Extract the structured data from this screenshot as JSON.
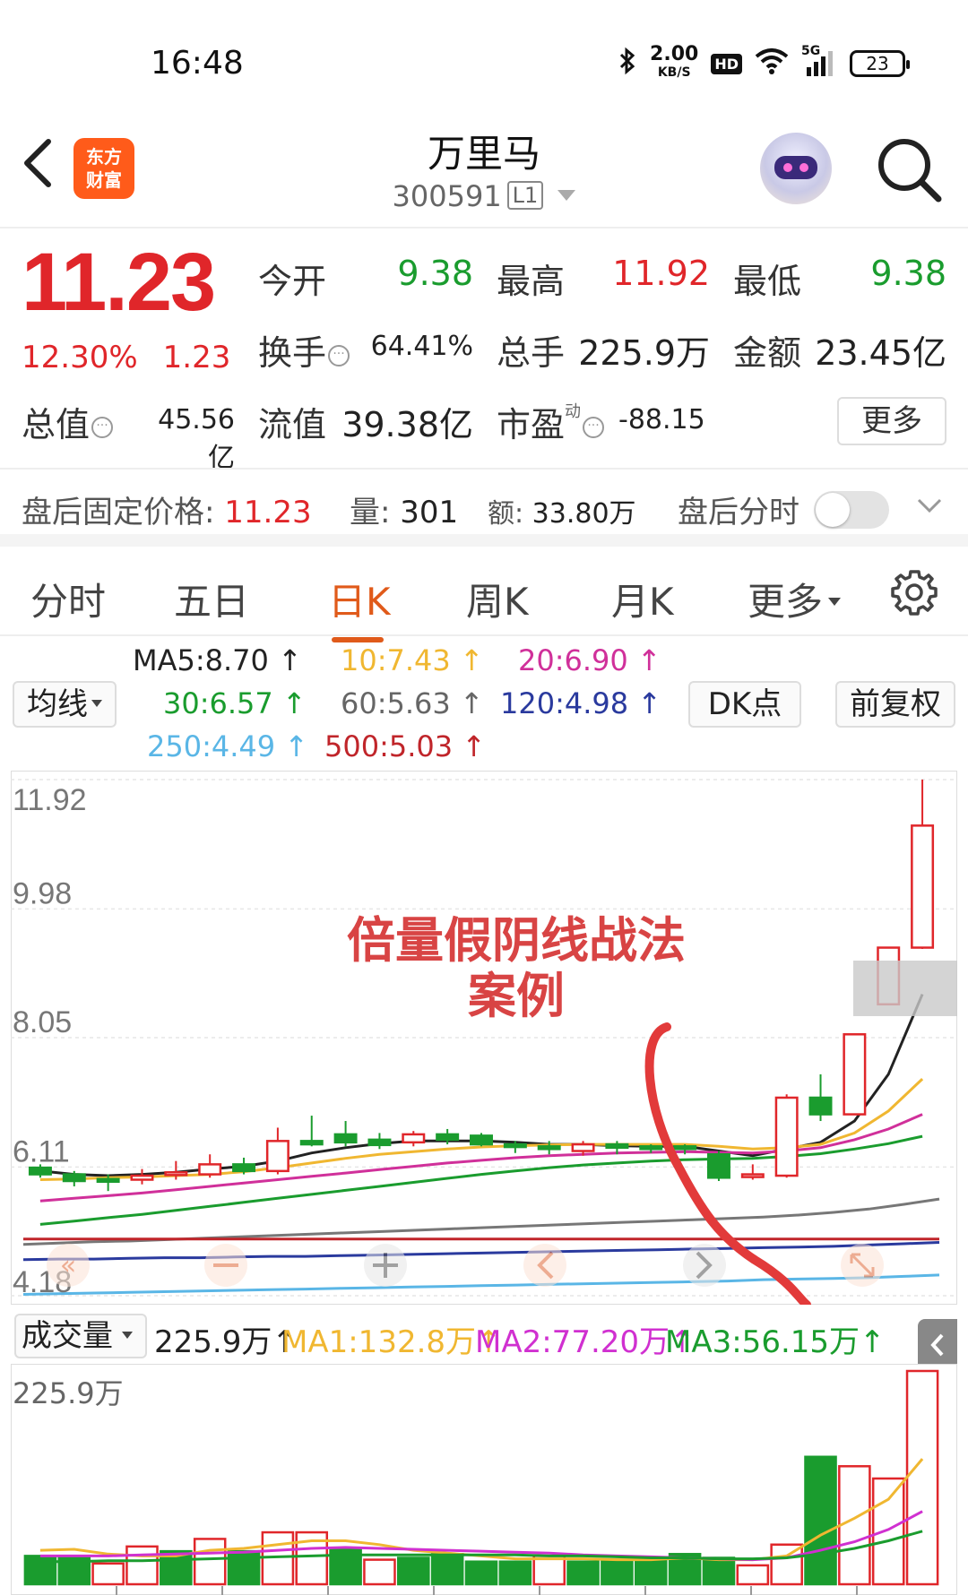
{
  "status": {
    "time": "16:48",
    "speed_top": "2.00",
    "speed_unit": "KB/S",
    "hd": "HD",
    "net": "5G",
    "battery": "23"
  },
  "header": {
    "logo_line1": "东方",
    "logo_line2": "财富",
    "title": "万里马",
    "code": "300591",
    "level": "L1"
  },
  "quote": {
    "price": "11.23",
    "change_pct": "12.30%",
    "change_amt": "1.23",
    "open_label": "今开",
    "open": "9.38",
    "high_label": "最高",
    "high": "11.92",
    "low_label": "最低",
    "low": "9.38",
    "turnover_label": "换手",
    "turnover": "64.41%",
    "volume_label": "总手",
    "volume": "225.9万",
    "amount_label": "金额",
    "amount": "23.45亿",
    "mktcap_label": "总值",
    "mktcap": "45.56亿",
    "float_label": "流值",
    "float_cap": "39.38亿",
    "pe_label": "市盈",
    "pe_sup": "动",
    "pe": "-88.15",
    "more": "更多"
  },
  "after_hours": {
    "price_label": "盘后固定价格:",
    "price": "11.23",
    "vol_label": "量:",
    "vol": "301",
    "amt_label": "额:",
    "amt": "33.80万",
    "intraday_label": "盘后分时"
  },
  "tabs": [
    "分时",
    "五日",
    "日K",
    "周K",
    "月K",
    "更多"
  ],
  "ma_legend": {
    "selector": "均线",
    "ma5": "MA5:8.70",
    "ma10": "10:7.43",
    "ma20": "20:6.90",
    "ma30": "30:6.57",
    "ma60": "60:5.63",
    "ma120": "120:4.98",
    "ma250": "250:4.49",
    "ma500": "500:5.03",
    "dk": "DK点",
    "adjust": "前复权",
    "arrow": "↑"
  },
  "colors": {
    "up": "#e0262a",
    "down": "#1a9c2e",
    "ma5": "#222222",
    "ma10": "#f0b731",
    "ma20": "#d0309a",
    "ma30": "#1a9c2e",
    "ma60": "#777777",
    "ma120": "#2a3a9e",
    "ma250": "#5ab6e6",
    "ma500": "#c0252a"
  },
  "annotation": {
    "line1": "倍量假阴线战法",
    "line2": "案例"
  },
  "chart_data": [
    {
      "type": "candlestick",
      "y_ticks": [
        "11.92",
        "9.98",
        "8.05",
        "6.11",
        "4.18"
      ],
      "ylim": [
        4.18,
        11.92
      ],
      "candles": [
        {
          "o": 6.1,
          "c": 6.0,
          "h": 6.15,
          "l": 5.95
        },
        {
          "o": 6.0,
          "c": 5.9,
          "h": 6.05,
          "l": 5.82
        },
        {
          "o": 5.93,
          "c": 5.92,
          "h": 6.0,
          "l": 5.75
        },
        {
          "o": 5.92,
          "c": 5.98,
          "h": 6.08,
          "l": 5.85
        },
        {
          "o": 6.0,
          "c": 6.03,
          "h": 6.2,
          "l": 5.92
        },
        {
          "o": 6.0,
          "c": 6.15,
          "h": 6.3,
          "l": 5.95
        },
        {
          "o": 6.15,
          "c": 6.05,
          "h": 6.25,
          "l": 6.0
        },
        {
          "o": 6.05,
          "c": 6.5,
          "h": 6.7,
          "l": 6.0
        },
        {
          "o": 6.5,
          "c": 6.45,
          "h": 6.88,
          "l": 6.42
        },
        {
          "o": 6.6,
          "c": 6.48,
          "h": 6.8,
          "l": 6.42
        },
        {
          "o": 6.52,
          "c": 6.44,
          "h": 6.62,
          "l": 6.38
        },
        {
          "o": 6.48,
          "c": 6.6,
          "h": 6.65,
          "l": 6.42
        },
        {
          "o": 6.6,
          "c": 6.52,
          "h": 6.68,
          "l": 6.45
        },
        {
          "o": 6.58,
          "c": 6.45,
          "h": 6.62,
          "l": 6.42
        },
        {
          "o": 6.45,
          "c": 6.43,
          "h": 6.5,
          "l": 6.32
        },
        {
          "o": 6.42,
          "c": 6.41,
          "h": 6.5,
          "l": 6.3
        },
        {
          "o": 6.35,
          "c": 6.45,
          "h": 6.5,
          "l": 6.28
        },
        {
          "o": 6.45,
          "c": 6.4,
          "h": 6.5,
          "l": 6.3
        },
        {
          "o": 6.42,
          "c": 6.4,
          "h": 6.45,
          "l": 6.32
        },
        {
          "o": 6.42,
          "c": 6.38,
          "h": 6.45,
          "l": 6.3
        },
        {
          "o": 6.3,
          "c": 5.95,
          "h": 6.35,
          "l": 5.9
        },
        {
          "o": 6.0,
          "c": 6.0,
          "h": 6.15,
          "l": 5.92
        },
        {
          "o": 5.98,
          "c": 7.15,
          "h": 7.2,
          "l": 5.95
        },
        {
          "o": 7.15,
          "c": 6.9,
          "h": 7.5,
          "l": 6.8
        },
        {
          "o": 6.9,
          "c": 8.1,
          "h": 8.1,
          "l": 6.9
        },
        {
          "o": 8.55,
          "c": 9.4,
          "h": 9.4,
          "l": 8.55
        },
        {
          "o": 9.4,
          "c": 11.23,
          "h": 11.92,
          "l": 9.38
        }
      ],
      "ma_lines": {
        "MA5": [
          6.05,
          6.0,
          5.98,
          6.0,
          6.03,
          6.08,
          6.12,
          6.2,
          6.32,
          6.4,
          6.46,
          6.5,
          6.5,
          6.5,
          6.48,
          6.45,
          6.45,
          6.43,
          6.42,
          6.42,
          6.35,
          6.28,
          6.38,
          6.48,
          6.8,
          7.5,
          8.7
        ],
        "MA10": [
          5.92,
          5.93,
          5.95,
          5.96,
          5.98,
          6.0,
          6.04,
          6.1,
          6.17,
          6.24,
          6.3,
          6.34,
          6.38,
          6.41,
          6.43,
          6.44,
          6.45,
          6.45,
          6.45,
          6.45,
          6.42,
          6.38,
          6.4,
          6.45,
          6.62,
          6.95,
          7.43
        ],
        "MA20": [
          5.6,
          5.64,
          5.68,
          5.72,
          5.77,
          5.82,
          5.87,
          5.92,
          5.97,
          6.02,
          6.07,
          6.12,
          6.17,
          6.21,
          6.25,
          6.28,
          6.3,
          6.32,
          6.33,
          6.34,
          6.33,
          6.32,
          6.35,
          6.4,
          6.52,
          6.68,
          6.9
        ],
        "MA30": [
          5.25,
          5.3,
          5.35,
          5.4,
          5.46,
          5.52,
          5.58,
          5.64,
          5.7,
          5.76,
          5.82,
          5.88,
          5.94,
          6.0,
          6.05,
          6.1,
          6.14,
          6.17,
          6.2,
          6.22,
          6.23,
          6.24,
          6.27,
          6.31,
          6.38,
          6.46,
          6.57
        ],
        "MA60": [
          4.95,
          4.97,
          4.99,
          5.0,
          5.02,
          5.04,
          5.06,
          5.08,
          5.1,
          5.12,
          5.14,
          5.16,
          5.18,
          5.2,
          5.22,
          5.24,
          5.26,
          5.28,
          5.3,
          5.32,
          5.34,
          5.36,
          5.39,
          5.43,
          5.48,
          5.55,
          5.63
        ],
        "MA120": [
          4.72,
          4.73,
          4.73,
          4.74,
          4.75,
          4.75,
          4.76,
          4.77,
          4.77,
          4.78,
          4.79,
          4.8,
          4.81,
          4.82,
          4.83,
          4.84,
          4.85,
          4.86,
          4.87,
          4.88,
          4.89,
          4.9,
          4.91,
          4.92,
          4.94,
          4.96,
          4.98
        ],
        "MA250": [
          4.2,
          4.21,
          4.22,
          4.23,
          4.24,
          4.25,
          4.26,
          4.27,
          4.28,
          4.29,
          4.3,
          4.31,
          4.32,
          4.33,
          4.34,
          4.35,
          4.36,
          4.37,
          4.38,
          4.39,
          4.4,
          4.42,
          4.43,
          4.44,
          4.45,
          4.47,
          4.49
        ],
        "MA500": [
          5.03,
          5.03,
          5.03,
          5.03,
          5.03,
          5.03,
          5.03,
          5.03,
          5.03,
          5.03,
          5.03,
          5.03,
          5.03,
          5.03,
          5.03,
          5.03,
          5.03,
          5.03,
          5.03,
          5.03,
          5.03,
          5.03,
          5.03,
          5.03,
          5.03,
          5.03,
          5.03
        ]
      }
    },
    {
      "type": "bar",
      "title": "成交量",
      "y_max_label": "225.9万",
      "ylim": [
        0,
        225.9
      ],
      "values": [
        30,
        28,
        22,
        40,
        35,
        48,
        35,
        55,
        55,
        38,
        26,
        28,
        32,
        24,
        24,
        30,
        24,
        26,
        27,
        32,
        28,
        20,
        42,
        135,
        125,
        112,
        225.9
      ],
      "up": [
        false,
        false,
        true,
        true,
        false,
        true,
        false,
        true,
        true,
        false,
        true,
        false,
        false,
        false,
        false,
        true,
        false,
        false,
        false,
        false,
        false,
        true,
        true,
        false,
        true,
        true,
        true
      ],
      "series_labels": {
        "vol": "225.9万",
        "ma1": "MA1:132.8万",
        "ma2": "MA2:77.20万",
        "ma3": "MA3:56.15万"
      },
      "ma_lines": {
        "MA1": [
          36,
          37,
          32,
          30,
          30,
          36,
          38,
          42,
          46,
          46,
          42,
          36,
          33,
          30,
          27,
          27,
          27,
          26,
          26,
          28,
          26,
          26,
          30,
          52,
          70,
          90,
          132.8
        ],
        "MA2": [
          30,
          30,
          30,
          31,
          32,
          33,
          34,
          36,
          38,
          39,
          38,
          37,
          36,
          35,
          34,
          33,
          31,
          30,
          29,
          28,
          27,
          26,
          28,
          36,
          45,
          58,
          77.2
        ],
        "MA3": [
          24,
          24,
          25,
          25,
          26,
          27,
          28,
          29,
          30,
          31,
          31,
          31,
          31,
          31,
          31,
          30,
          30,
          29,
          28,
          28,
          27,
          27,
          28,
          32,
          38,
          46,
          56.15
        ]
      }
    }
  ]
}
